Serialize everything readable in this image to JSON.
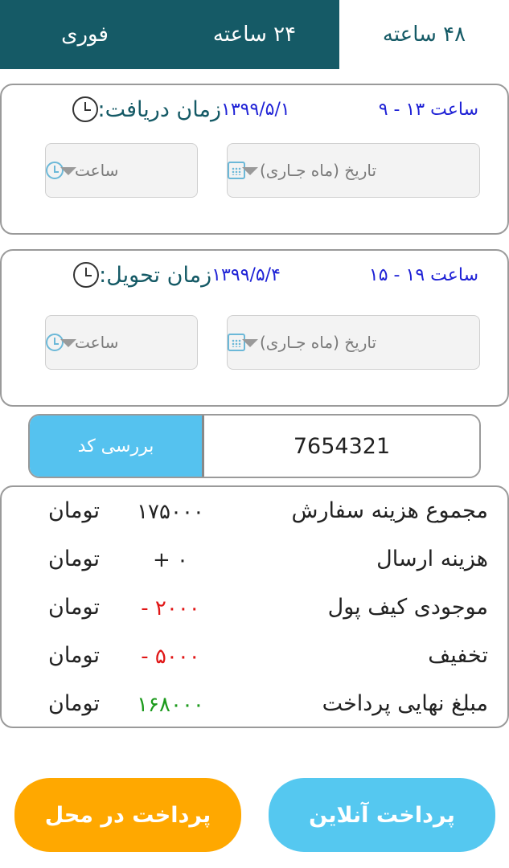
{
  "tabs": [
    {
      "label": "۴۸ ساعته",
      "active": true
    },
    {
      "label": "۲۴ ساعته",
      "active": false
    },
    {
      "label": "فوری",
      "active": false
    }
  ],
  "pickup": {
    "label": "زمان دریافت:",
    "date": "۱۳۹۹/۵/۱",
    "slot": "ساعت ۱۳ - ۹",
    "date_placeholder": "تاریخ (ماه جـاری)",
    "time_placeholder": "ساعت"
  },
  "delivery": {
    "label": "زمان تحویل:",
    "date": "۱۳۹۹/۵/۴",
    "slot": "ساعت ۱۹ - ۱۵",
    "date_placeholder": "تاریخ (ماه جـاری)",
    "time_placeholder": "ساعت"
  },
  "code": {
    "value": "7654321",
    "check_label": "بررسی کد"
  },
  "summary": {
    "rows": [
      {
        "label": "مجموع هزینه سفارش",
        "amount": "۱۷۵۰۰۰",
        "currency": "تومان"
      },
      {
        "label": "هزینه ارسال",
        "amount": "۰ +",
        "currency": "تومان"
      },
      {
        "label": "موجودی کیف پول",
        "amount": "۲۰۰۰ -",
        "currency": "تومان"
      },
      {
        "label": "تخفیف",
        "amount": "۵۰۰۰ -",
        "currency": "تومان"
      },
      {
        "label": "مبلغ نهایی پرداخت",
        "amount": "۱۶۸۰۰۰",
        "currency": "تومان"
      }
    ]
  },
  "buttons": {
    "online": "پرداخت آنلاین",
    "cash": "پرداخت در محل"
  },
  "colors": {
    "header": "#155a66",
    "accent_blue": "#55c2ef",
    "accent_orange": "#ffa800",
    "negative": "#e01515",
    "total": "#1c9a1c",
    "date_text": "#1f22d6"
  }
}
